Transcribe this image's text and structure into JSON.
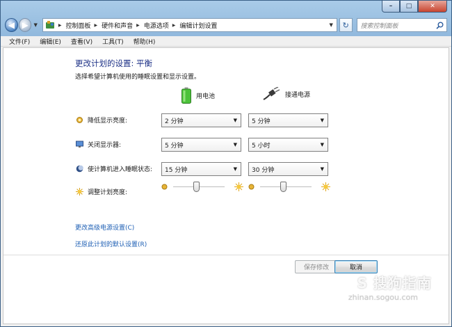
{
  "window": {
    "caption": {
      "minimize": "–",
      "maximize": "□",
      "close": "✕"
    }
  },
  "nav": {
    "back": "◀",
    "forward": "▶",
    "breadcrumbs": [
      "控制面板",
      "硬件和声音",
      "电源选项",
      "编辑计划设置"
    ],
    "search_placeholder": "搜索控制面板",
    "refresh": "↻"
  },
  "menu": [
    "文件(F)",
    "编辑(E)",
    "查看(V)",
    "工具(T)",
    "帮助(H)"
  ],
  "page": {
    "title": "更改计划的设置: 平衡",
    "subtitle": "选择希望计算机使用的睡眠设置和显示设置。",
    "columns": {
      "battery": "用电池",
      "plugged": "接通电源"
    },
    "rows": [
      {
        "label": "降低显示亮度:",
        "battery": "2 分钟",
        "plugged": "5 分钟",
        "icon": "dim-icon"
      },
      {
        "label": "关闭显示器:",
        "battery": "5 分钟",
        "plugged": "5 小时",
        "icon": "monitor-icon"
      },
      {
        "label": "使计算机进入睡眠状态:",
        "battery": "15 分钟",
        "plugged": "30 分钟",
        "icon": "moon-icon"
      }
    ],
    "brightness": {
      "label": "调整计划亮度:",
      "battery_level": 0.45,
      "plugged_level": 0.45
    },
    "links": {
      "advanced": "更改高级电源设置(C)",
      "restore": "还原此计划的默认设置(R)"
    },
    "buttons": {
      "save": "保存修改",
      "cancel": "取消"
    }
  },
  "watermark": {
    "logo": "S 搜狗指南",
    "url": "zhinan.sogou.com"
  },
  "colors": {
    "title": "#1e3287",
    "link": "#1e5fb4",
    "battery_green": "#4cc23a"
  }
}
